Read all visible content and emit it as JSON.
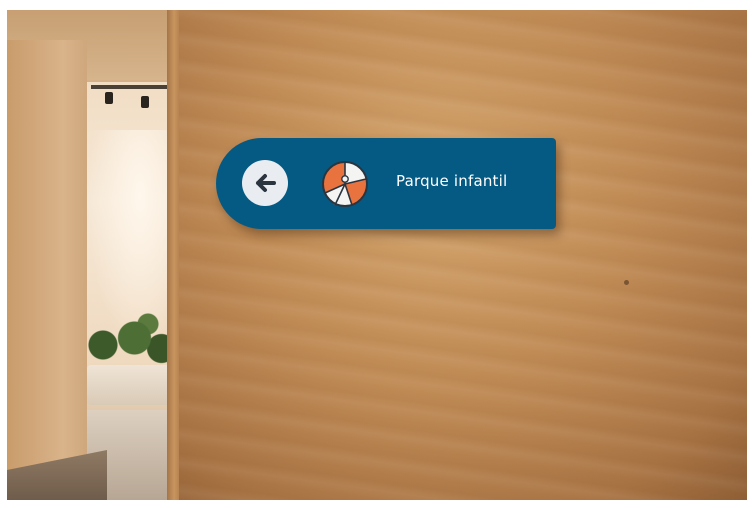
{
  "sign": {
    "label": "Parque infantil",
    "direction_icon": "arrow-left-icon",
    "category_icon": "beach-ball-icon",
    "background_color": "#055a84",
    "text_color": "#ffffff",
    "icon_accent_color": "#e8733f"
  }
}
